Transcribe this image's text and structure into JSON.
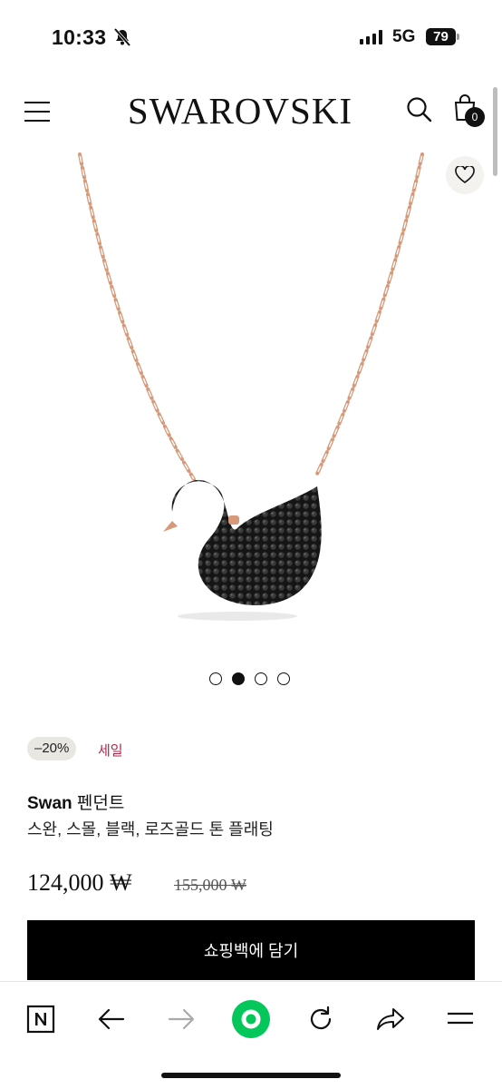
{
  "status_bar": {
    "time": "10:33",
    "network": "5G",
    "battery": "79"
  },
  "header": {
    "logo": "SWAROVSKI",
    "bag_count": "0"
  },
  "gallery": {
    "image_count": 4,
    "active_index": 1
  },
  "product": {
    "discount_badge": "–20%",
    "sale_label": "세일",
    "name_bold": "Swan",
    "name_rest": " 펜던트",
    "variant": "스완, 스몰, 블랙, 로즈골드 톤 플래팅",
    "price": "124,000 ₩",
    "original_price": "155,000 ₩"
  },
  "cta": {
    "add_to_bag": "쇼핑백에 담기"
  },
  "colors": {
    "accent_sale": "#b0274b",
    "naver_green": "#03c75a",
    "chain": "#d69a7a"
  }
}
